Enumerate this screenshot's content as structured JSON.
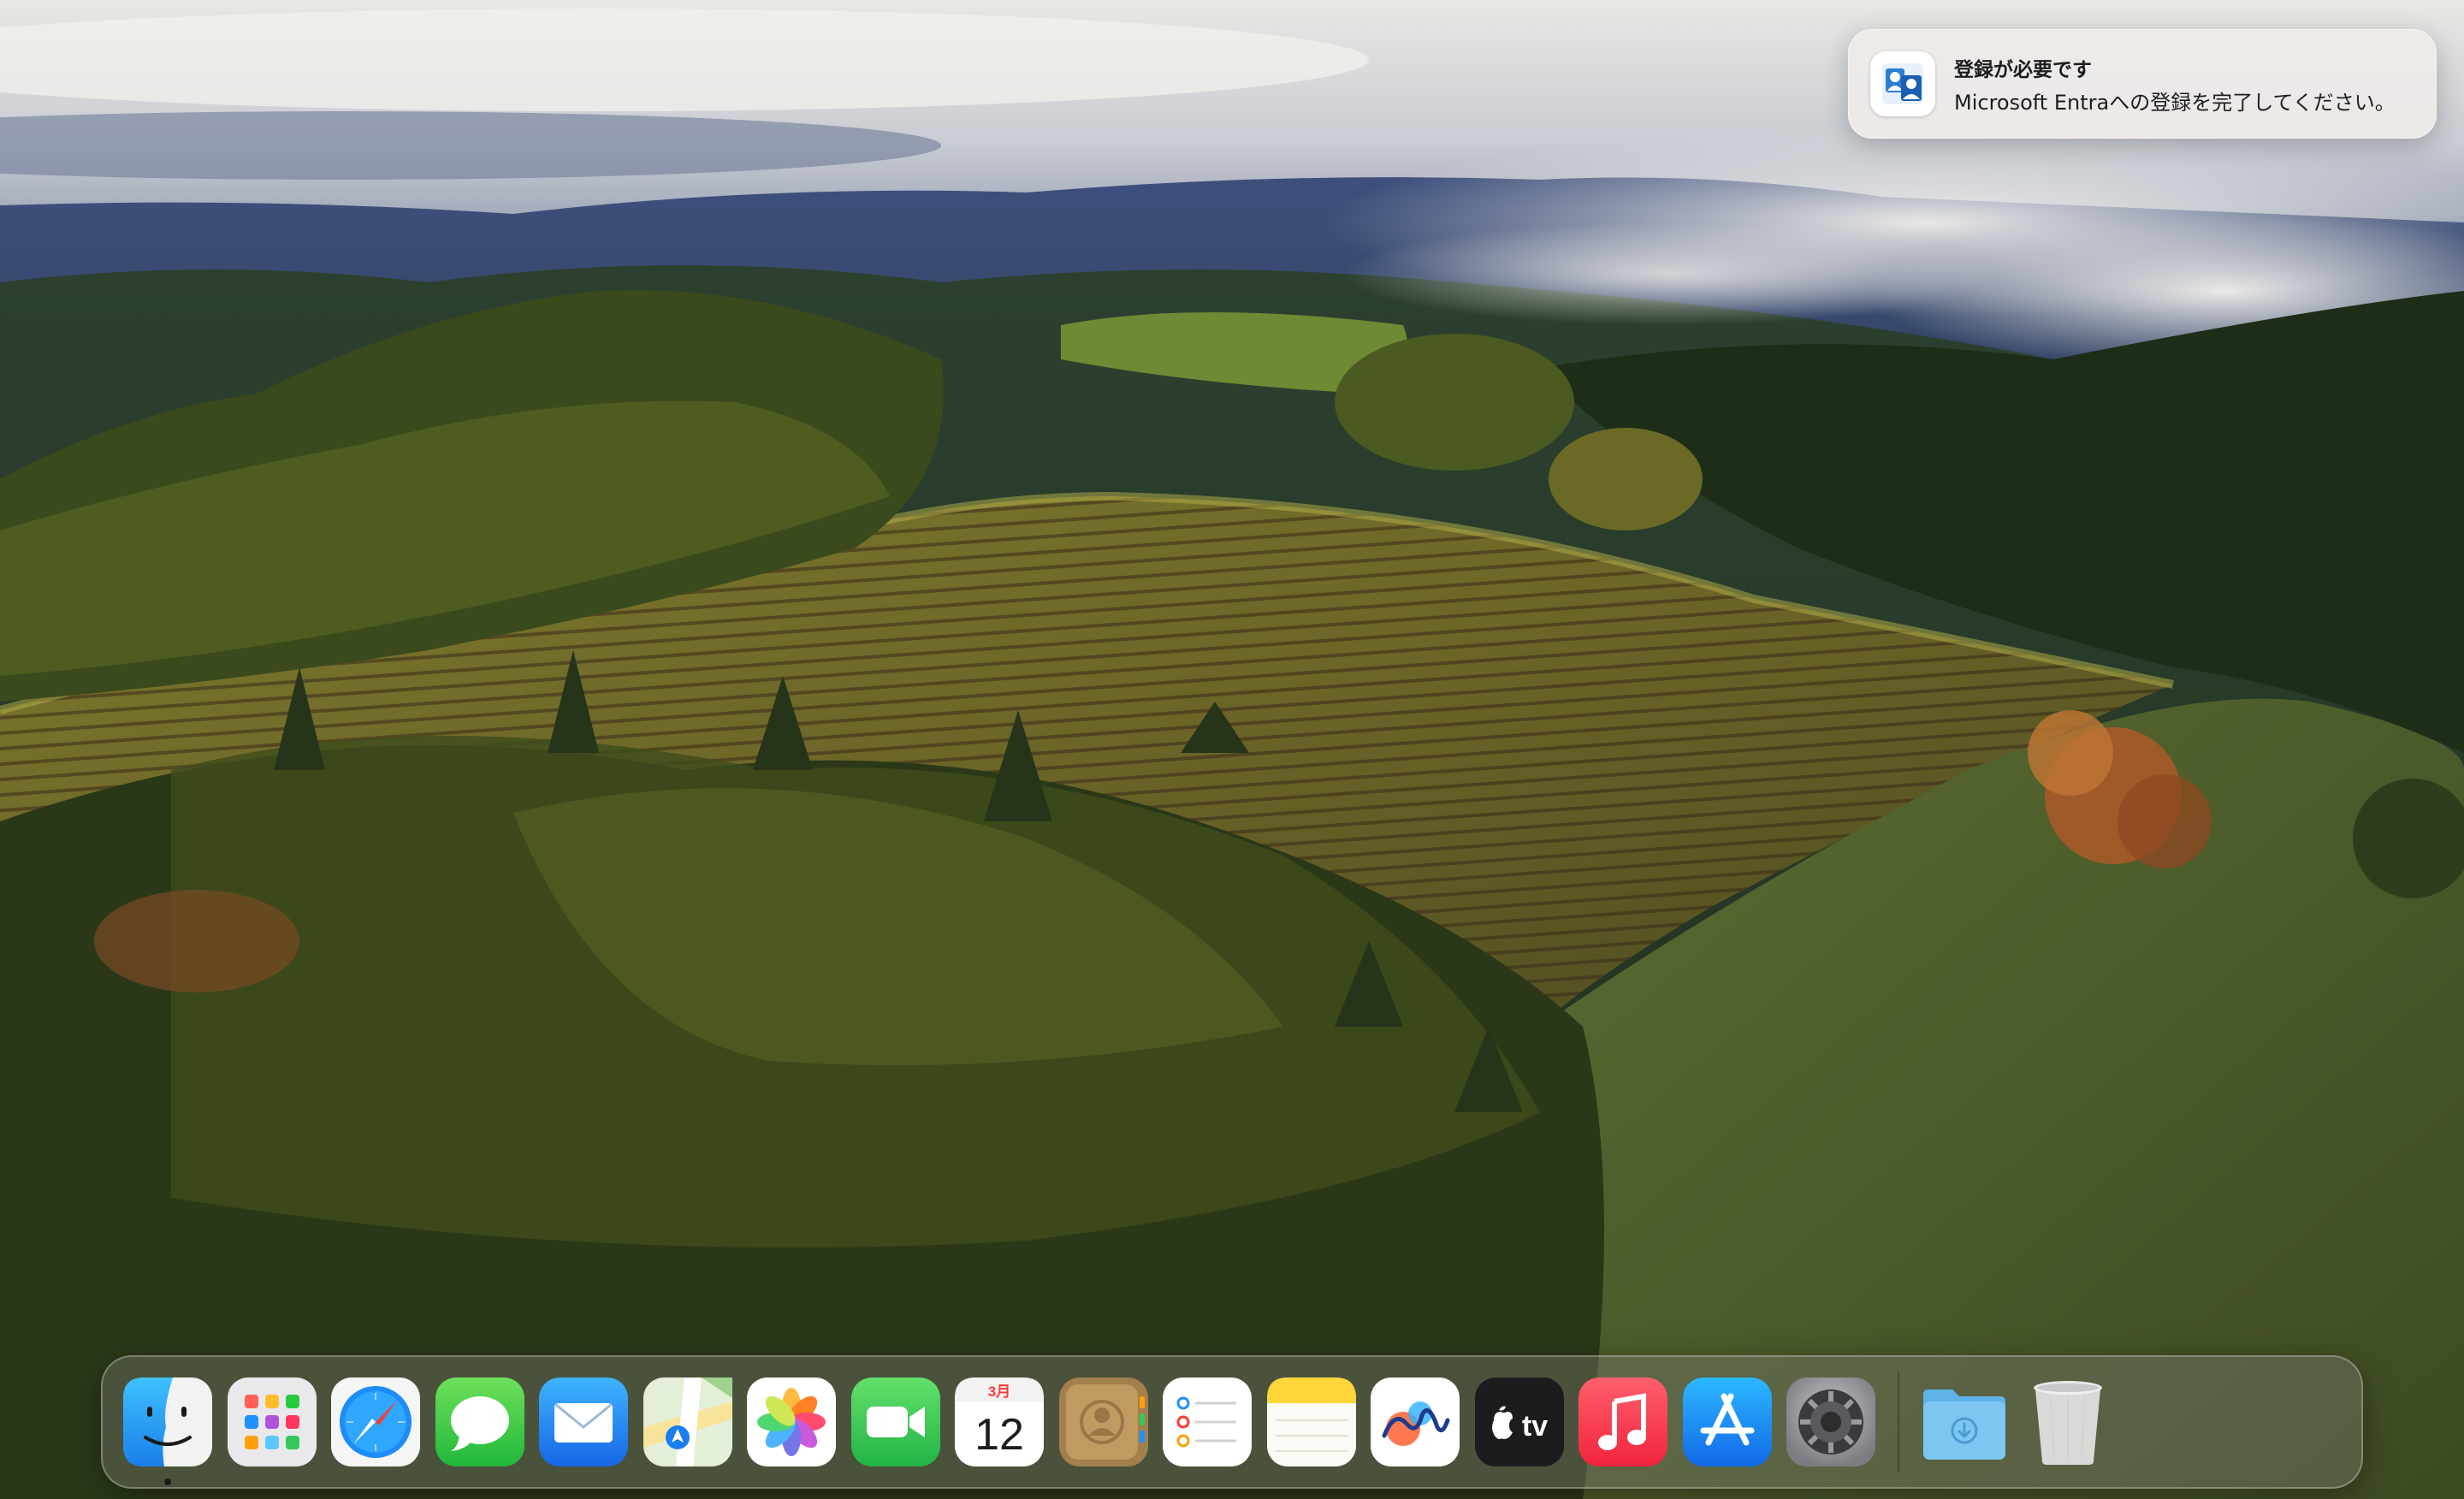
{
  "notification": {
    "app_icon": "microsoft-entra-icon",
    "title": "登録が必要です",
    "body": "Microsoft Entraへの登録を完了してください。"
  },
  "dock": {
    "apps": [
      {
        "id": "finder",
        "name": "Finder",
        "icon": "finder-icon",
        "running": true
      },
      {
        "id": "launchpad",
        "name": "Launchpad",
        "icon": "launchpad-icon",
        "running": false
      },
      {
        "id": "safari",
        "name": "Safari",
        "icon": "safari-icon",
        "running": false
      },
      {
        "id": "messages",
        "name": "Messages",
        "icon": "messages-icon",
        "running": false
      },
      {
        "id": "mail",
        "name": "Mail",
        "icon": "mail-icon",
        "running": false
      },
      {
        "id": "maps",
        "name": "Maps",
        "icon": "maps-icon",
        "running": false
      },
      {
        "id": "photos",
        "name": "Photos",
        "icon": "photos-icon",
        "running": false
      },
      {
        "id": "facetime",
        "name": "FaceTime",
        "icon": "facetime-icon",
        "running": false
      },
      {
        "id": "calendar",
        "name": "Calendar",
        "icon": "calendar-icon",
        "running": false
      },
      {
        "id": "contacts",
        "name": "Contacts",
        "icon": "contacts-icon",
        "running": false
      },
      {
        "id": "reminders",
        "name": "Reminders",
        "icon": "reminders-icon",
        "running": false
      },
      {
        "id": "notes",
        "name": "Notes",
        "icon": "notes-icon",
        "running": false
      },
      {
        "id": "freeform",
        "name": "Freeform",
        "icon": "freeform-icon",
        "running": false
      },
      {
        "id": "tv",
        "name": "TV",
        "icon": "tv-icon",
        "running": false
      },
      {
        "id": "music",
        "name": "Music",
        "icon": "music-icon",
        "running": false
      },
      {
        "id": "appstore",
        "name": "App Store",
        "icon": "app-store-icon",
        "running": false
      },
      {
        "id": "settings",
        "name": "System Settings",
        "icon": "gear-icon",
        "running": false
      }
    ],
    "calendar": {
      "month": "3月",
      "day": "12"
    },
    "tv_label": "tv",
    "stack": [
      {
        "id": "downloads",
        "name": "Downloads",
        "icon": "downloads-folder-icon"
      },
      {
        "id": "trash",
        "name": "Trash",
        "icon": "trash-icon"
      }
    ]
  },
  "colors": {
    "notification_bg": "#eeebe8",
    "dock_bg": "#78786e",
    "sky": "#d9dbe0",
    "foliage": "#3d4f1e"
  }
}
